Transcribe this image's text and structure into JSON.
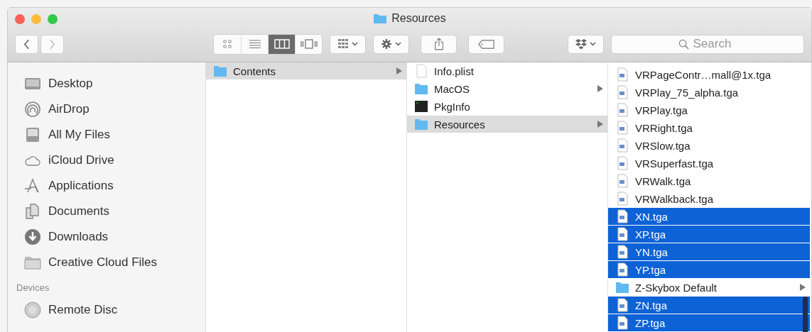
{
  "window": {
    "title": "Resources"
  },
  "toolbar": {
    "views": [
      {
        "kind": "icons",
        "selected": false
      },
      {
        "kind": "list",
        "selected": false
      },
      {
        "kind": "columns",
        "selected": true
      },
      {
        "kind": "coverflow",
        "selected": false
      }
    ],
    "search": {
      "placeholder": "Search"
    }
  },
  "sidebar": {
    "favorites": [
      {
        "label": "Desktop",
        "kind": "desktop"
      },
      {
        "label": "AirDrop",
        "kind": "airdrop"
      },
      {
        "label": "All My Files",
        "kind": "allfiles"
      },
      {
        "label": "iCloud Drive",
        "kind": "cloud"
      },
      {
        "label": "Applications",
        "kind": "apps"
      },
      {
        "label": "Documents",
        "kind": "documents"
      },
      {
        "label": "Downloads",
        "kind": "downloads"
      },
      {
        "label": "Creative Cloud Files",
        "kind": "folder"
      }
    ],
    "devices_heading": "Devices",
    "devices": [
      {
        "label": "Remote Disc",
        "kind": "disc"
      }
    ]
  },
  "columns": [
    {
      "active": false,
      "items": [
        {
          "name": "Contents",
          "kind": "folder",
          "selected": true
        }
      ]
    },
    {
      "active": false,
      "items": [
        {
          "name": "Info.plist",
          "kind": "file",
          "selected": false
        },
        {
          "name": "MacOS",
          "kind": "folder",
          "selected": false
        },
        {
          "name": "PkgInfo",
          "kind": "exec",
          "selected": false
        },
        {
          "name": "Resources",
          "kind": "folder",
          "selected": true
        }
      ]
    },
    {
      "active": true,
      "items": [
        {
          "name": "VRPageContr…mall@1x.tga",
          "kind": "image",
          "selected": false
        },
        {
          "name": "VRPlay_75_alpha.tga",
          "kind": "image",
          "selected": false
        },
        {
          "name": "VRPlay.tga",
          "kind": "image",
          "selected": false
        },
        {
          "name": "VRRight.tga",
          "kind": "image",
          "selected": false
        },
        {
          "name": "VRSlow.tga",
          "kind": "image",
          "selected": false
        },
        {
          "name": "VRSuperfast.tga",
          "kind": "image",
          "selected": false
        },
        {
          "name": "VRWalk.tga",
          "kind": "image",
          "selected": false
        },
        {
          "name": "VRWalkback.tga",
          "kind": "image",
          "selected": false
        },
        {
          "name": "XN.tga",
          "kind": "image",
          "selected": true
        },
        {
          "name": "XP.tga",
          "kind": "image",
          "selected": true
        },
        {
          "name": "YN.tga",
          "kind": "image",
          "selected": true
        },
        {
          "name": "YP.tga",
          "kind": "image",
          "selected": true
        },
        {
          "name": "Z-Skybox Default",
          "kind": "folder",
          "selected": false
        },
        {
          "name": "ZN.tga",
          "kind": "image",
          "selected": true
        },
        {
          "name": "ZP.tga",
          "kind": "image",
          "selected": true
        }
      ]
    }
  ]
}
